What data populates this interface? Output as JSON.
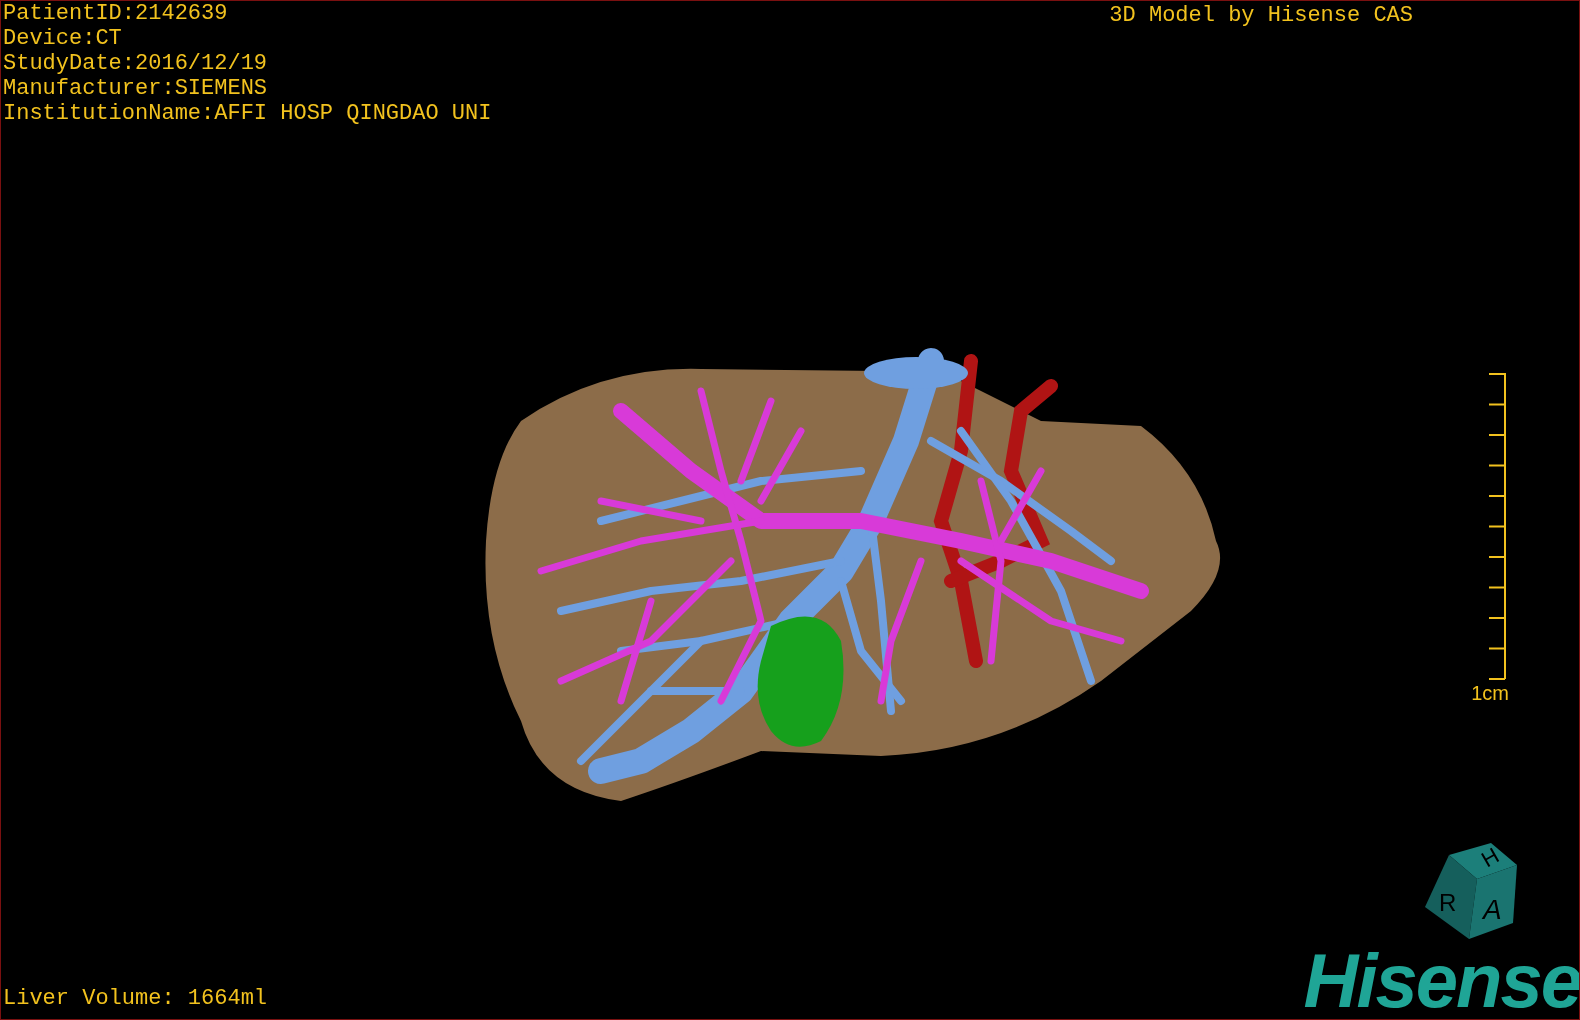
{
  "study_info": [
    "PatientID:2142639",
    "Device:CT",
    "StudyDate:2016/12/19",
    "Manufacturer:SIEMENS",
    "InstitutionName:AFFI HOSP QINGDAO UNI"
  ],
  "credit": "3D Model by Hisense CAS",
  "scale_bar": {
    "label": "1cm"
  },
  "liver_volume": "Liver Volume: 1664ml",
  "orientation_cube": {
    "top": "H",
    "left": "R",
    "front": "A"
  },
  "logo": "Hisense"
}
